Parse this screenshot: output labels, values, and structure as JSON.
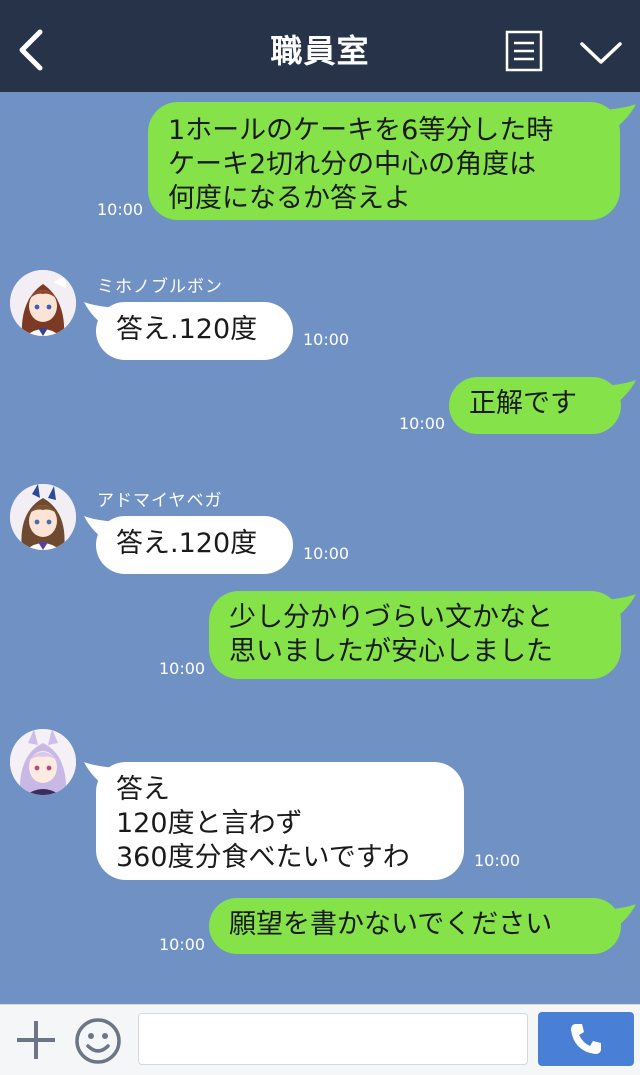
{
  "header": {
    "title": "職員室"
  },
  "messages": [
    {
      "sender": "",
      "text": "1ホールのケーキを6等分した時\nケーキ2切れ分の中心の角度は\n何度になるか答えよ",
      "time": "10:00"
    },
    {
      "sender": "ミホノブルボン",
      "text": "答え.120度",
      "time": "10:00"
    },
    {
      "sender": "",
      "text": "正解です",
      "time": "10:00"
    },
    {
      "sender": "アドマイヤベガ",
      "text": "答え.120度",
      "time": "10:00"
    },
    {
      "sender": "",
      "text": "少し分かりづらい文かなと\n思いましたが安心しました",
      "time": "10:00"
    },
    {
      "sender": "",
      "text": "答え\n120度と言わず\n360度分食べたいですわ",
      "time": "10:00"
    },
    {
      "sender": "",
      "text": "願望を書かないでください",
      "time": "10:00"
    }
  ],
  "footer": {
    "input_value": ""
  },
  "icons": [
    "back-icon",
    "menu-icon",
    "chevron-down-icon",
    "plus-icon",
    "emoji-icon",
    "phone-icon"
  ],
  "colors": {
    "header": "#273349",
    "chat_background": "#7091c4",
    "outgoing_bubble": "#85e249",
    "incoming_bubble": "#ffffff",
    "send_button": "#4a7fd6"
  }
}
